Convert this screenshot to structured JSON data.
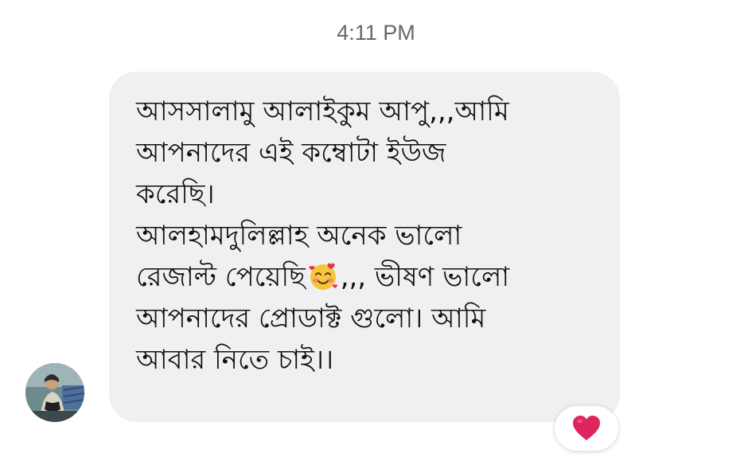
{
  "timestamp": "4:11 PM",
  "message": {
    "lines": [
      "আসসালামু আলাইকুম আপু,,,আমি",
      "আপনাদের এই কম্বোটা ইউজ",
      "করেছি।",
      "আলহামদুলিল্লাহ অনেক ভালো"
    ],
    "line5_before_emoji": "রেজাল্ট পেয়েছি",
    "emoji": "smiling-face-with-hearts",
    "line5_after_emoji": ",,, ভীষণ ভালো",
    "lines_after": [
      "আপনাদের প্রোডাক্ট গুলো। আমি",
      "আবার নিতে চাই।।"
    ]
  },
  "reaction": {
    "icon": "heart-icon",
    "color": "#e0245e"
  },
  "avatar": {
    "icon": "user-avatar"
  }
}
